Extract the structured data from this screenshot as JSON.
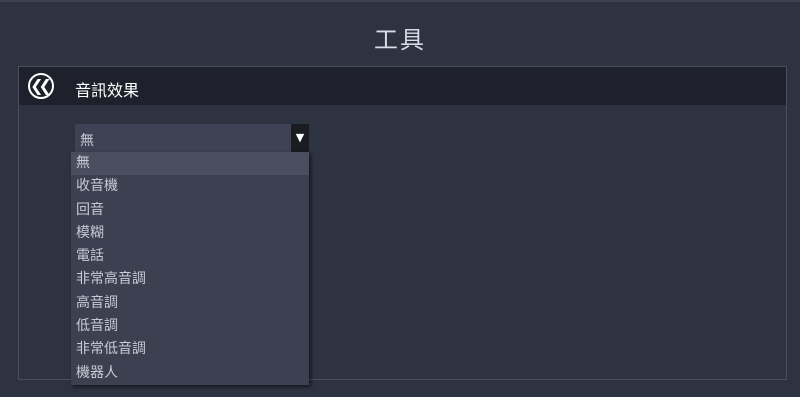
{
  "window": {
    "title": "工具"
  },
  "panel": {
    "title": "音訊效果",
    "back_icon": "double-chevron-left-circle-icon"
  },
  "select": {
    "value": "無",
    "arrow_icon": "caret-down-icon",
    "options": [
      {
        "label": "無",
        "selected": true
      },
      {
        "label": "收音機",
        "selected": false
      },
      {
        "label": "回音",
        "selected": false
      },
      {
        "label": "模糊",
        "selected": false
      },
      {
        "label": "電話",
        "selected": false
      },
      {
        "label": "非常高音調",
        "selected": false
      },
      {
        "label": "高音調",
        "selected": false
      },
      {
        "label": "低音調",
        "selected": false
      },
      {
        "label": "非常低音調",
        "selected": false
      },
      {
        "label": "機器人",
        "selected": false
      }
    ]
  },
  "colors": {
    "background": "#2e3342",
    "header": "#1e212b",
    "dropdown": "#3c4152",
    "highlight": "#4a4f60"
  }
}
